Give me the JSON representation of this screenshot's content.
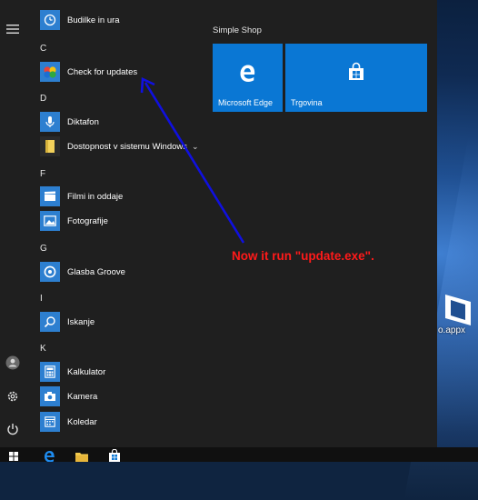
{
  "menu": {
    "sections": [
      {
        "letter": "",
        "apps": [
          {
            "label": "Budilke in ura",
            "icon": "alarm-clock-icon"
          }
        ]
      },
      {
        "letter": "C",
        "apps": [
          {
            "label": "Check for updates",
            "icon": "windows-logo-icon"
          }
        ]
      },
      {
        "letter": "D",
        "apps": [
          {
            "label": "Diktafon",
            "icon": "microphone-icon"
          },
          {
            "label": "Dostopnost v sistemu Windows",
            "icon": "folder-icon",
            "expandable": true
          }
        ]
      },
      {
        "letter": "F",
        "apps": [
          {
            "label": "Filmi in oddaje",
            "icon": "film-icon"
          },
          {
            "label": "Fotografije",
            "icon": "photo-icon"
          }
        ]
      },
      {
        "letter": "G",
        "apps": [
          {
            "label": "Glasba Groove",
            "icon": "groove-music-icon"
          }
        ]
      },
      {
        "letter": "I",
        "apps": [
          {
            "label": "Iskanje",
            "icon": "search-icon"
          }
        ]
      },
      {
        "letter": "K",
        "apps": [
          {
            "label": "Kalkulator",
            "icon": "calculator-icon"
          },
          {
            "label": "Kamera",
            "icon": "camera-icon"
          },
          {
            "label": "Koledar",
            "icon": "calendar-icon"
          }
        ]
      }
    ],
    "tile_group": {
      "title": "Simple Shop",
      "tiles": [
        {
          "label": "Microsoft Edge",
          "icon": "edge-icon"
        },
        {
          "label": "Trgovina",
          "icon": "store-icon"
        }
      ]
    },
    "rail": [
      "hamburger-menu-icon",
      "user-icon",
      "settings-gear-icon",
      "power-icon"
    ]
  },
  "annotation": {
    "text": "Now it run \"update.exe\"."
  },
  "desktop": {
    "icon_label": "o.appx"
  },
  "taskbar": {
    "items": [
      "start-icon",
      "edge-icon",
      "file-explorer-icon",
      "store-icon"
    ]
  },
  "colors": {
    "accent": "#0a77d4",
    "annotation_text": "#ff1a1a",
    "arrow": "#1010e0"
  }
}
